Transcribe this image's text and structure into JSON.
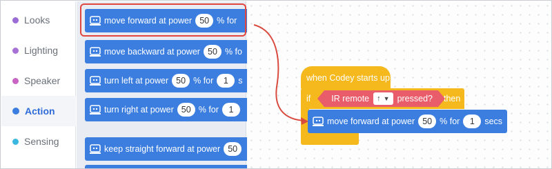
{
  "categories": [
    {
      "label": "Looks",
      "color": "#9b6bd6",
      "active": false
    },
    {
      "label": "Lighting",
      "color": "#a771d6",
      "active": false
    },
    {
      "label": "Speaker",
      "color": "#c964c4",
      "active": false
    },
    {
      "label": "Action",
      "color": "#3b7ee0",
      "active": true
    },
    {
      "label": "Sensing",
      "color": "#3cb8e0",
      "active": false
    }
  ],
  "palette": {
    "block1": {
      "text": "move forward at power",
      "power": "50",
      "suffix": "% for"
    },
    "block2": {
      "text": "move backward at power",
      "power": "50",
      "suffix": "% fo"
    },
    "block3": {
      "text": "turn left at power",
      "power": "50",
      "middle": "% for",
      "seconds": "1",
      "suffix": "s"
    },
    "block4": {
      "text": "turn right at power",
      "power": "50",
      "middle": "% for",
      "seconds": "1"
    },
    "block5": {
      "text": "keep straight  forward at power",
      "power": "50"
    }
  },
  "script": {
    "hat_label": "when Codey starts up",
    "if_label": "if",
    "condition_text": "IR remote",
    "condition_key": "↑",
    "condition_suffix": "pressed?",
    "then_label": "then",
    "inner": {
      "text": "move forward at power",
      "power": "50",
      "middle": "% for",
      "seconds": "1",
      "unit": "secs"
    }
  },
  "colors": {
    "motion_block": "#3b7ee0",
    "event_block": "#f5b91e",
    "sensing_block": "#e95c6a",
    "highlight": "#e0463e"
  }
}
